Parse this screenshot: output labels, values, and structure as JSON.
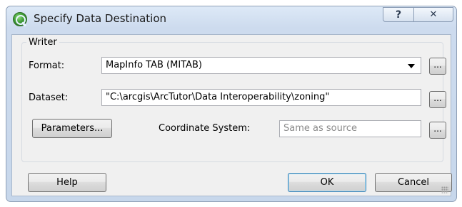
{
  "window": {
    "title": "Specify Data Destination",
    "help_glyph": "?",
    "close_glyph": "✕"
  },
  "writer": {
    "group_label": "Writer",
    "format_label": "Format:",
    "format_value": "MapInfo TAB (MITAB)",
    "dataset_label": "Dataset:",
    "dataset_value": "\"C:\\arcgis\\ArcTutor\\Data Interoperability\\zoning\"",
    "browse_label": "...",
    "parameters_label": "Parameters...",
    "coord_label": "Coordinate System:",
    "coord_value": "Same as source"
  },
  "buttons": {
    "help": "Help",
    "ok": "OK",
    "cancel": "Cancel"
  },
  "icons": {
    "app": "qgis-icon",
    "dropdown": "chevron-down-icon"
  }
}
